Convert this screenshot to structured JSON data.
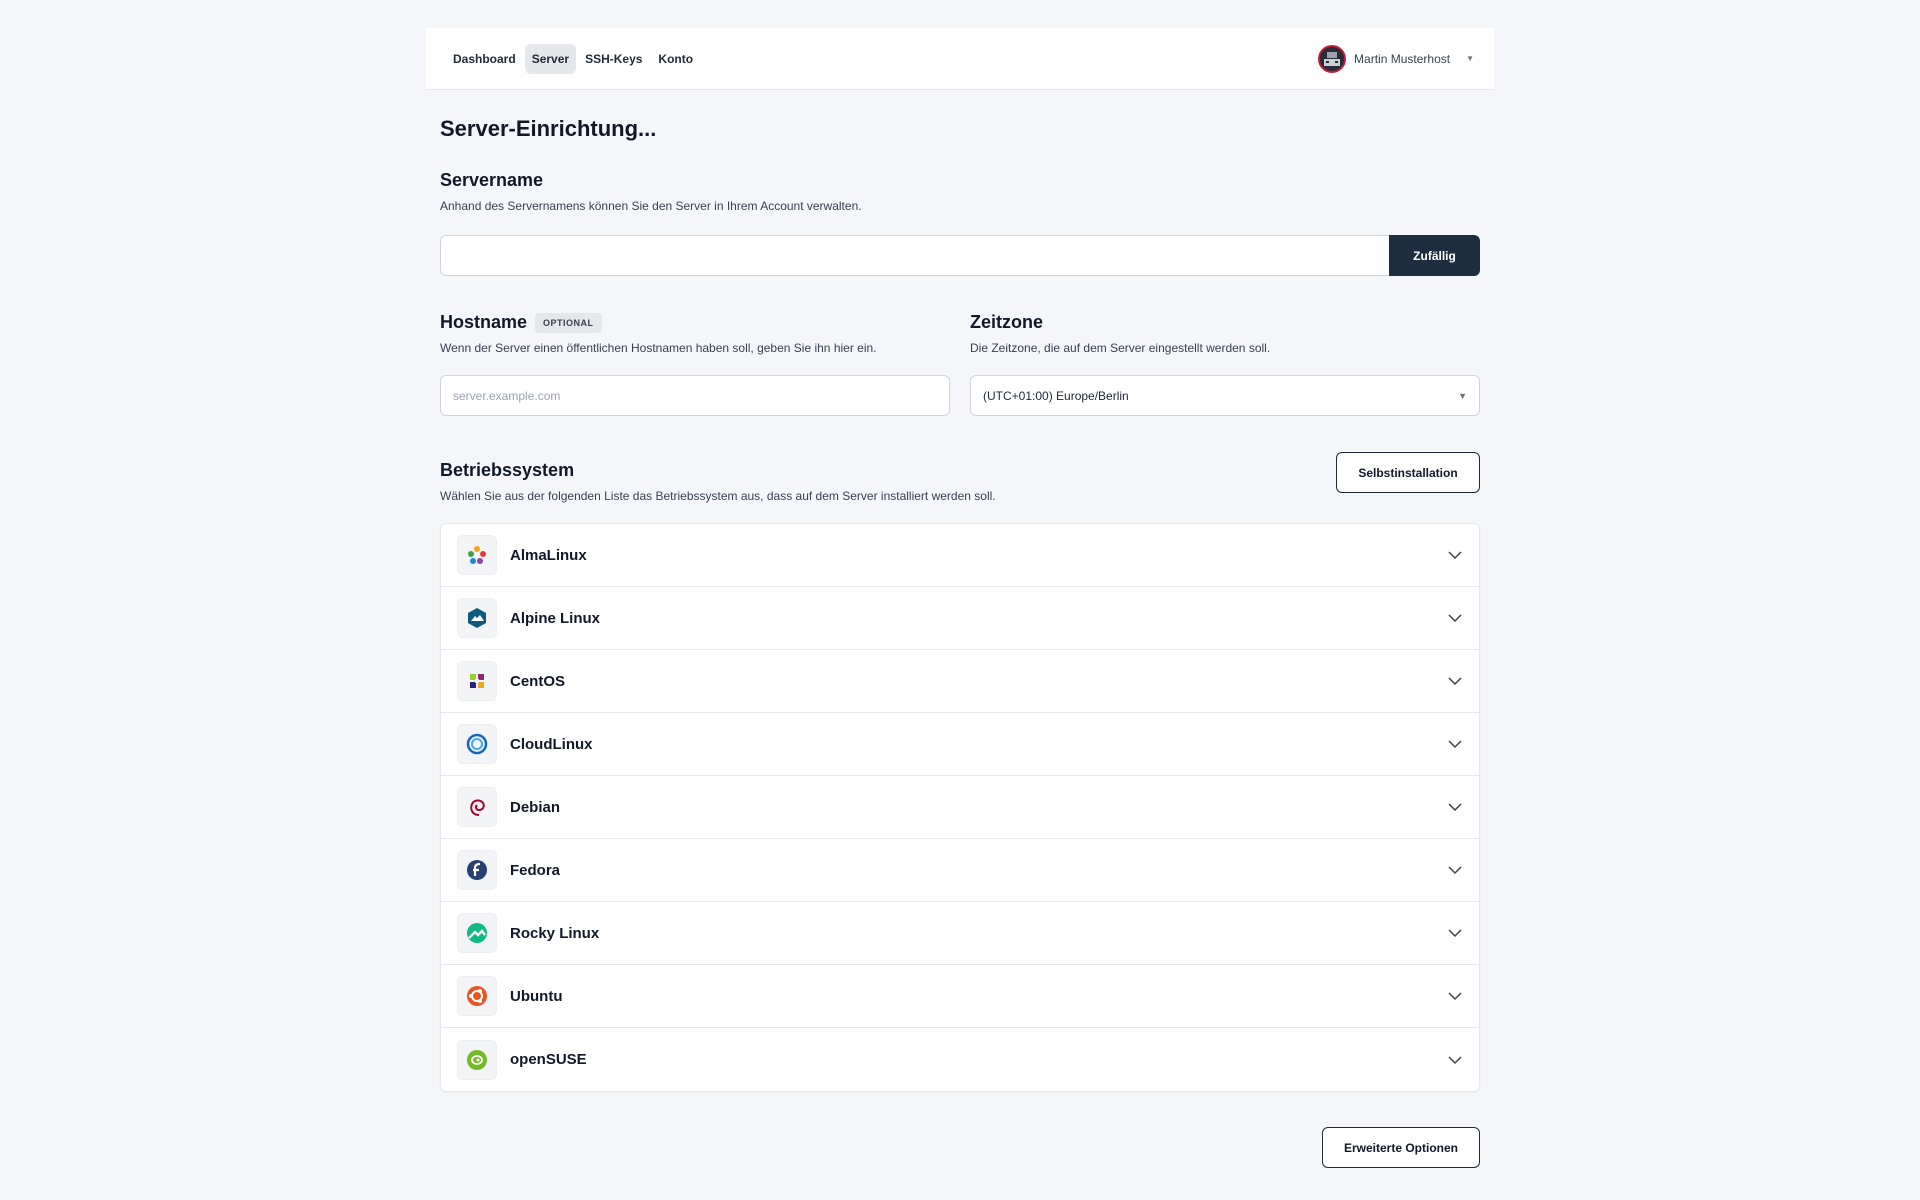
{
  "nav": {
    "items": [
      {
        "label": "Dashboard",
        "active": false
      },
      {
        "label": "Server",
        "active": true
      },
      {
        "label": "SSH-Keys",
        "active": false
      },
      {
        "label": "Konto",
        "active": false
      }
    ]
  },
  "user": {
    "name": "Martin Musterhost",
    "avatar_icon": "avatar-icon"
  },
  "page": {
    "title": "Server-Einrichtung..."
  },
  "servername": {
    "title": "Servername",
    "description": "Anhand des Servernamens können Sie den Server in Ihrem Account verwalten.",
    "value": "",
    "random_button": "Zufällig"
  },
  "hostname": {
    "title": "Hostname",
    "badge": "OPTIONAL",
    "description": "Wenn der Server einen öffentlichen Hostnamen haben soll, geben Sie ihn hier ein.",
    "placeholder": "server.example.com"
  },
  "timezone": {
    "title": "Zeitzone",
    "description": "Die Zeitzone, die auf dem Server eingestellt werden soll.",
    "selected": "(UTC+01:00) Europe/Berlin"
  },
  "os": {
    "title": "Betriebssystem",
    "description": "Wählen Sie aus der folgenden Liste das Betriebssystem aus, dass auf dem Server installiert werden soll.",
    "self_install_button": "Selbstinstallation",
    "items": [
      {
        "label": "AlmaLinux",
        "icon": "almalinux-icon"
      },
      {
        "label": "Alpine Linux",
        "icon": "alpine-icon"
      },
      {
        "label": "CentOS",
        "icon": "centos-icon"
      },
      {
        "label": "CloudLinux",
        "icon": "cloudlinux-icon"
      },
      {
        "label": "Debian",
        "icon": "debian-icon"
      },
      {
        "label": "Fedora",
        "icon": "fedora-icon"
      },
      {
        "label": "Rocky Linux",
        "icon": "rocky-icon"
      },
      {
        "label": "Ubuntu",
        "icon": "ubuntu-icon"
      },
      {
        "label": "openSUSE",
        "icon": "opensuse-icon"
      }
    ]
  },
  "advanced_button": "Erweiterte Optionen",
  "colors": {
    "primary_dark": "#1e2d40",
    "background": "#f4f6f9"
  }
}
